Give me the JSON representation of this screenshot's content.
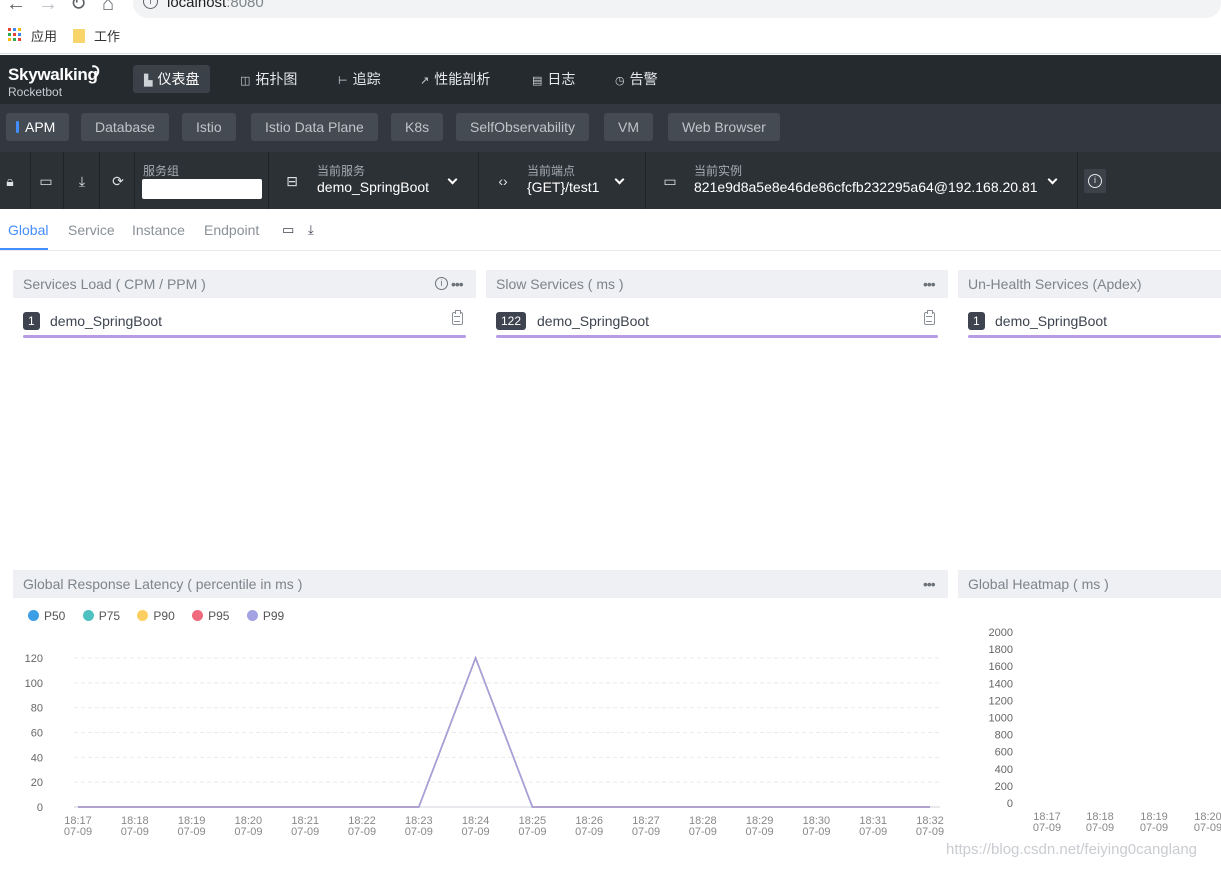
{
  "browser": {
    "url_host": "localhost",
    "url_port": ":8080",
    "bookmarks": [
      {
        "label": "应用"
      },
      {
        "label": "工作"
      }
    ]
  },
  "topnav": {
    "logo_title": "Skywalking",
    "logo_subtitle": "Rocketbot",
    "items": [
      {
        "label": "仪表盘",
        "icon": "chart-icon",
        "active": true
      },
      {
        "label": "拓扑图",
        "icon": "topology-icon"
      },
      {
        "label": "追踪",
        "icon": "trace-icon"
      },
      {
        "label": "性能剖析",
        "icon": "profile-icon"
      },
      {
        "label": "日志",
        "icon": "log-icon"
      },
      {
        "label": "告警",
        "icon": "alarm-icon"
      }
    ]
  },
  "layers": [
    {
      "label": "APM",
      "active": true
    },
    {
      "label": "Database"
    },
    {
      "label": "Istio"
    },
    {
      "label": "Istio Data Plane"
    },
    {
      "label": "K8s"
    },
    {
      "label": "SelfObservability"
    },
    {
      "label": "VM"
    },
    {
      "label": "Web Browser"
    }
  ],
  "selectors": {
    "group_label": "服务组",
    "group_value": "",
    "service_label": "当前服务",
    "service_value": "demo_SpringBoot",
    "endpoint_label": "当前端点",
    "endpoint_value": "{GET}/test1",
    "instance_label": "当前实例",
    "instance_value": "821e9d8a5e8e46de86cfcfb232295a64@192.168.20.81"
  },
  "dashboard_tabs": [
    {
      "label": "Global",
      "active": true
    },
    {
      "label": "Service"
    },
    {
      "label": "Instance"
    },
    {
      "label": "Endpoint"
    }
  ],
  "panels": {
    "services_load": {
      "title": "Services Load ( CPM / PPM )",
      "rows": [
        {
          "rank": "1",
          "name": "demo_SpringBoot"
        }
      ]
    },
    "slow_services": {
      "title": "Slow Services ( ms )",
      "rows": [
        {
          "rank": "122",
          "name": "demo_SpringBoot"
        }
      ]
    },
    "unhealth_services": {
      "title": "Un-Health Services (Apdex)",
      "rows": [
        {
          "rank": "1",
          "name": "demo_SpringBoot"
        }
      ]
    },
    "latency": {
      "title": "Global Response Latency ( percentile in ms )"
    },
    "heatmap": {
      "title": "Global Heatmap ( ms )"
    }
  },
  "colors": {
    "accent": "#448dfe",
    "topnav_bg": "#252a2f",
    "layerbar_bg": "#333840",
    "selbar_bg": "#2c3136",
    "purple_bar": "#b79be4"
  },
  "chart_data": [
    {
      "type": "line",
      "title": "Global Response Latency ( percentile in ms )",
      "x": [
        "18:17\n07-09",
        "18:18\n07-09",
        "18:19\n07-09",
        "18:20\n07-09",
        "18:21\n07-09",
        "18:22\n07-09",
        "18:23\n07-09",
        "18:24\n07-09",
        "18:25\n07-09",
        "18:26\n07-09",
        "18:27\n07-09",
        "18:28\n07-09",
        "18:29\n07-09",
        "18:30\n07-09",
        "18:31\n07-09",
        "18:32\n07-09"
      ],
      "x_time": [
        "18:17",
        "18:18",
        "18:19",
        "18:20",
        "18:21",
        "18:22",
        "18:23",
        "18:24",
        "18:25",
        "18:26",
        "18:27",
        "18:28",
        "18:29",
        "18:30",
        "18:31",
        "18:32"
      ],
      "x_date": "07-09",
      "ylim": [
        0,
        120
      ],
      "yticks": [
        0,
        20,
        40,
        60,
        80,
        100,
        120
      ],
      "grid": true,
      "legend_position": "top-left",
      "series": [
        {
          "name": "P50",
          "color": "#3c9ee5",
          "values": [
            0,
            0,
            0,
            0,
            0,
            0,
            0,
            120,
            0,
            0,
            0,
            0,
            0,
            0,
            0,
            0
          ]
        },
        {
          "name": "P75",
          "color": "#4fc1c0",
          "values": [
            0,
            0,
            0,
            0,
            0,
            0,
            0,
            120,
            0,
            0,
            0,
            0,
            0,
            0,
            0,
            0
          ]
        },
        {
          "name": "P90",
          "color": "#fcd060",
          "values": [
            0,
            0,
            0,
            0,
            0,
            0,
            0,
            120,
            0,
            0,
            0,
            0,
            0,
            0,
            0,
            0
          ]
        },
        {
          "name": "P95",
          "color": "#f06a7e",
          "values": [
            0,
            0,
            0,
            0,
            0,
            0,
            0,
            120,
            0,
            0,
            0,
            0,
            0,
            0,
            0,
            0
          ]
        },
        {
          "name": "P99",
          "color": "#a3a3e3",
          "values": [
            0,
            0,
            0,
            0,
            0,
            0,
            0,
            120,
            0,
            0,
            0,
            0,
            0,
            0,
            0,
            0
          ]
        }
      ]
    },
    {
      "type": "heatmap",
      "title": "Global Heatmap ( ms )",
      "x_time": [
        "18:17",
        "18:18",
        "18:19",
        "18:20"
      ],
      "x_date": "07-09",
      "ylim": [
        0,
        2000
      ],
      "yticks": [
        0,
        200,
        400,
        600,
        800,
        1000,
        1200,
        1400,
        1600,
        1800,
        2000
      ]
    }
  ],
  "watermark": "https://blog.csdn.net/feiying0canglang"
}
